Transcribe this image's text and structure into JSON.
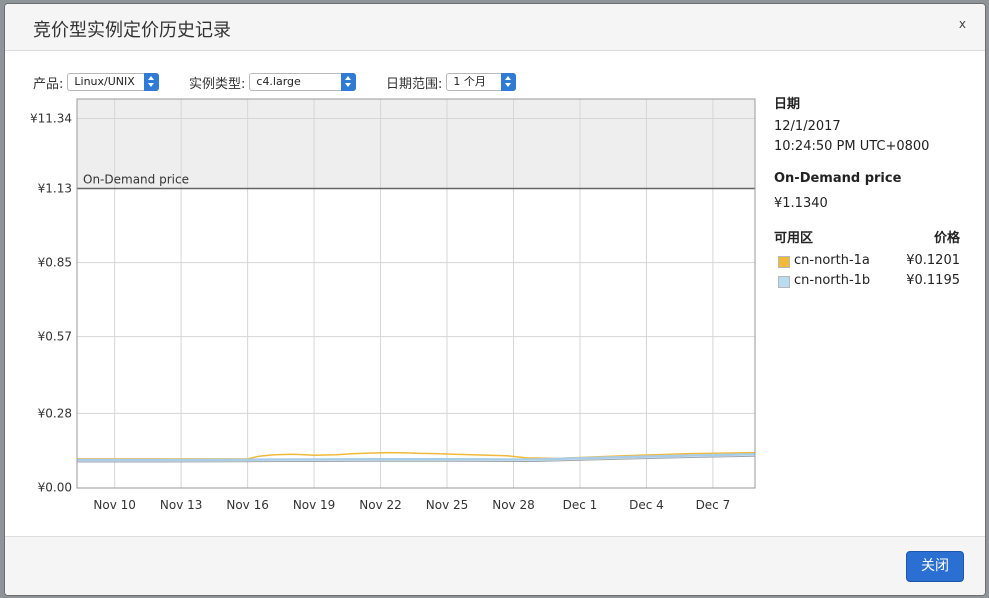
{
  "modal": {
    "title": "竞价型实例定价历史记录",
    "close_glyph": "x"
  },
  "controls": {
    "product_label": "产品:",
    "product_value": "Linux/UNIX",
    "instance_label": "实例类型:",
    "instance_value": "c4.large",
    "range_label": "日期范围:",
    "range_value": "1 个月"
  },
  "chart_data": {
    "type": "line",
    "title": "",
    "xlabel": "",
    "ylabel": "",
    "x_ticks": [
      "Nov 10",
      "Nov 13",
      "Nov 16",
      "Nov 19",
      "Nov 22",
      "Nov 25",
      "Nov 28",
      "Dec 1",
      "Dec 4",
      "Dec 7"
    ],
    "y_ticks": [
      "¥0.00",
      "¥0.28",
      "¥0.57",
      "¥0.85",
      "¥1.13",
      "¥11.34"
    ],
    "y_tick_values": [
      0,
      0.28,
      0.57,
      0.85,
      1.13,
      11.34
    ],
    "x_range": [
      8.3,
      38.9
    ],
    "on_demand_label": "On-Demand price",
    "on_demand_price": 1.134,
    "grid": true,
    "series": [
      {
        "name": "cn-north-1a",
        "color": "#f0b93a",
        "x": [
          8.3,
          16.0,
          16.5,
          17.2,
          18.1,
          19.0,
          20.0,
          20.8,
          21.5,
          22.2,
          23.0,
          23.8,
          24.5,
          25.3,
          26.1,
          26.9,
          27.7,
          28.6,
          30.0,
          33.0,
          36.0,
          38.9
        ],
        "values": [
          0.108,
          0.108,
          0.118,
          0.124,
          0.126,
          0.122,
          0.124,
          0.128,
          0.13,
          0.132,
          0.131,
          0.129,
          0.128,
          0.126,
          0.124,
          0.122,
          0.12,
          0.112,
          0.11,
          0.12,
          0.128,
          0.132
        ]
      },
      {
        "name": "cn-north-1b",
        "color": "#a8cde8",
        "x": [
          8.3,
          12.0,
          16.0,
          19.0,
          22.0,
          25.0,
          28.0,
          29.0,
          30.0,
          33.0,
          36.0,
          38.9
        ],
        "values": [
          0.104,
          0.104,
          0.105,
          0.106,
          0.107,
          0.107,
          0.106,
          0.106,
          0.108,
          0.115,
          0.121,
          0.126
        ]
      }
    ]
  },
  "sidebar": {
    "date_heading": "日期",
    "date_value": "12/1/2017",
    "time_value": "10:24:50 PM UTC+0800",
    "on_demand_heading": "On-Demand price",
    "on_demand_value": "¥1.1340",
    "az_header": "可用区",
    "price_header": "价格",
    "zones": [
      {
        "name": "cn-north-1a",
        "price": "¥0.1201",
        "color": "#f0b93a"
      },
      {
        "name": "cn-north-1b",
        "price": "¥0.1195",
        "color": "#b9dcf3"
      }
    ]
  },
  "footer": {
    "close_label": "关闭"
  }
}
